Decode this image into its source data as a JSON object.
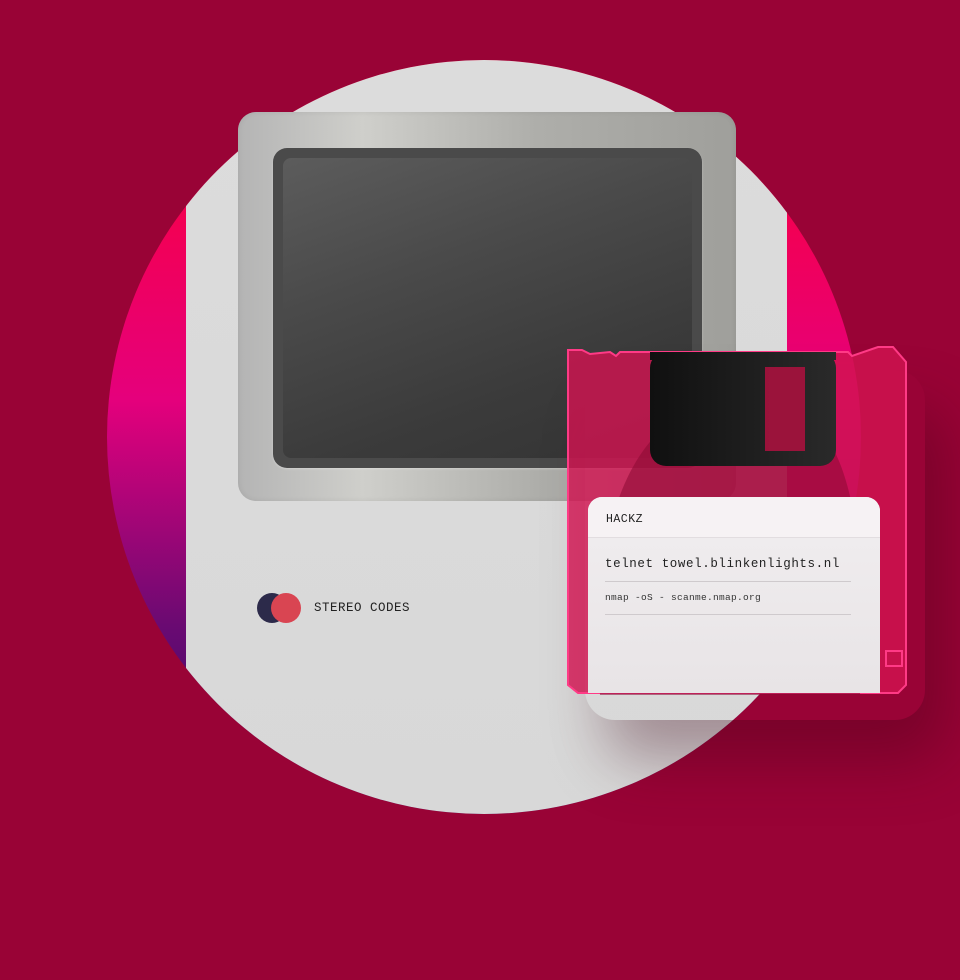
{
  "brand": {
    "name": "STEREO CODES"
  },
  "floppy": {
    "label_title": "HACKZ",
    "lines": [
      "telnet towel.blinkenlights.nl",
      "nmap -oS - scanme.nmap.org"
    ]
  },
  "colors": {
    "background": "#990336",
    "circle_gradient": [
      "#ff0038",
      "#e3007a",
      "#3a0a6e"
    ],
    "computer_body": "#d9d9d9",
    "screen": "#444444",
    "disk_pink": "#e8175d",
    "logo_dark": "#2c2a4a",
    "logo_red": "#d94552"
  }
}
